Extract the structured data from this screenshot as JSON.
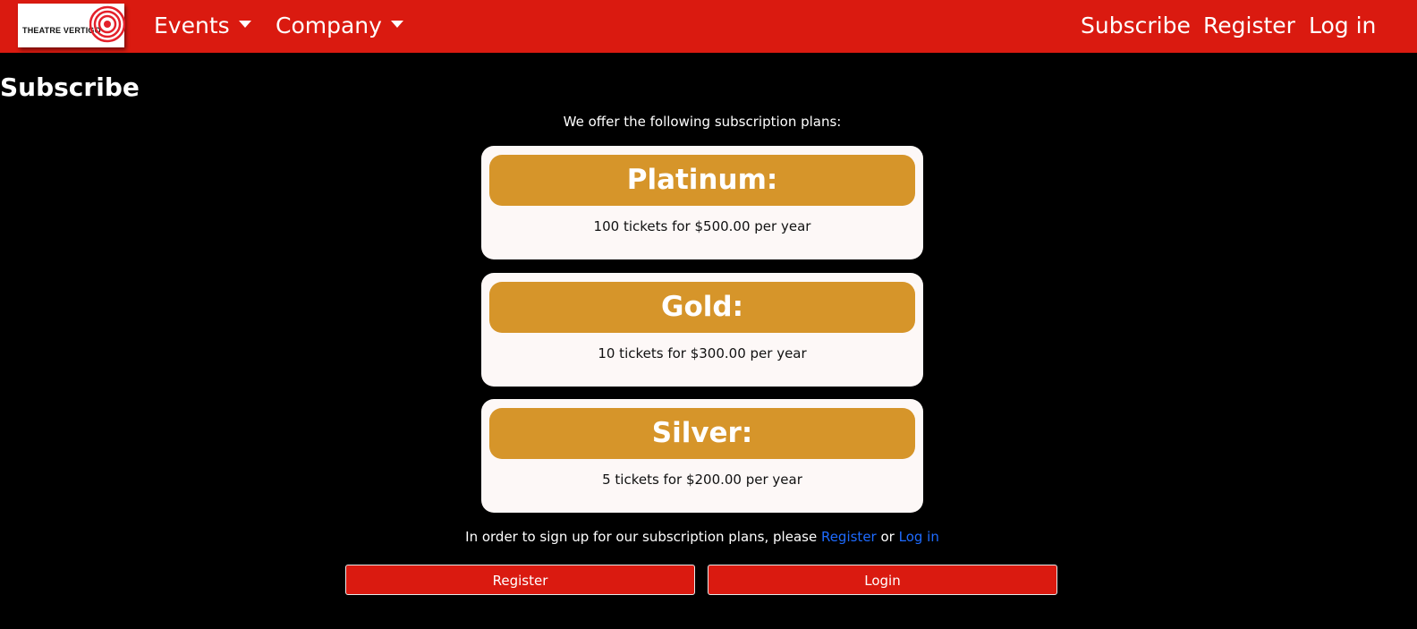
{
  "navbar": {
    "logo_text": "THEATRE VERTIGO",
    "menus": [
      {
        "label": "Events"
      },
      {
        "label": "Company"
      }
    ],
    "links": [
      {
        "label": "Subscribe"
      },
      {
        "label": "Register"
      },
      {
        "label": "Log in"
      }
    ],
    "colors": {
      "bar": "#da1a10"
    }
  },
  "page": {
    "title": "Subscribe",
    "intro": "We offer the following subscription plans:"
  },
  "plans": [
    {
      "name": "Platinum:",
      "description": "100 tickets for $500.00 per year"
    },
    {
      "name": "Gold:",
      "description": "10 tickets for $300.00 per year"
    },
    {
      "name": "Silver:",
      "description": "5 tickets for $200.00 per year"
    }
  ],
  "signup": {
    "text_before": "In order to sign up for our subscription plans, please ",
    "register_link": "Register",
    "text_middle": " or ",
    "login_link": "Log in"
  },
  "buttons": {
    "register": "Register",
    "login": "Login"
  },
  "colors": {
    "plan_header": "#d6952a",
    "plan_card": "#fdf8f7",
    "link": "#1e6bff",
    "button": "#da1a10"
  }
}
